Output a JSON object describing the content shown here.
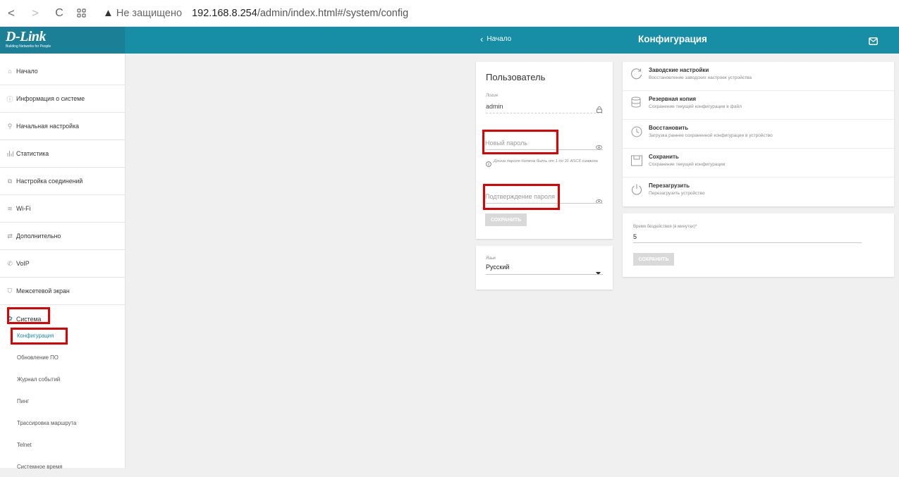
{
  "browser": {
    "back": "<",
    "forward": ">",
    "reload": "C",
    "insecure_label": "Не защищено",
    "url_host": "192.168.8.254",
    "url_path": "/admin/index.html#/system/config"
  },
  "logo": {
    "name": "D-Link",
    "tagline": "Building Networks for People"
  },
  "header": {
    "back_label": "Начало",
    "title": "Конфигурация",
    "accent": "#178ea5"
  },
  "sidebar": {
    "items": [
      {
        "label": "Начало",
        "icon": "home-icon"
      },
      {
        "label": "Информация о системе",
        "icon": "info-icon"
      },
      {
        "label": "Начальная настройка",
        "icon": "wand-icon"
      },
      {
        "label": "Статистика",
        "icon": "bar-chart-icon"
      },
      {
        "label": "Настройка соединений",
        "icon": "connections-icon"
      },
      {
        "label": "Wi-Fi",
        "icon": "wifi-icon"
      },
      {
        "label": "Дополнительно",
        "icon": "sliders-icon"
      },
      {
        "label": "VoIP",
        "icon": "phone-icon"
      },
      {
        "label": "Межсетевой экран",
        "icon": "shield-icon"
      },
      {
        "label": "Система",
        "icon": "gear-icon"
      }
    ],
    "subitems": [
      {
        "label": "Конфигурация",
        "active": true
      },
      {
        "label": "Обновление ПО"
      },
      {
        "label": "Журнал событий"
      },
      {
        "label": "Пинг"
      },
      {
        "label": "Трассировка маршрута"
      },
      {
        "label": "Telnet"
      },
      {
        "label": "Системное время"
      }
    ]
  },
  "user_panel": {
    "title": "Пользователь",
    "login_label": "Логин",
    "login_value": "admin",
    "new_password_placeholder": "Новый пароль",
    "password_note": "Длина пароля должна быть от 1 до 31 ASCII символа",
    "confirm_placeholder": "Подтверждение пароля",
    "save_label": "СОХРАНИТЬ"
  },
  "language_panel": {
    "label": "Язык",
    "value": "Русский"
  },
  "actions": [
    {
      "title": "Заводские настройки",
      "desc": "Восстановление заводских настроек устройства",
      "icon": "reset-icon"
    },
    {
      "title": "Резервная копия",
      "desc": "Сохранение текущей конфигурации в файл",
      "icon": "database-icon"
    },
    {
      "title": "Восстановить",
      "desc": "Загрузка раннее сохраненной конфигурации в устройство",
      "icon": "history-icon"
    },
    {
      "title": "Сохранить",
      "desc": "Сохранение текущей конфигурации",
      "icon": "floppy-icon"
    },
    {
      "title": "Перезагрузить",
      "desc": "Перезагрузить устройство",
      "icon": "power-icon"
    }
  ],
  "idle_panel": {
    "label": "Время бездействия (в минутах)*",
    "value": "5",
    "save_label": "СОХРАНИТЬ"
  }
}
